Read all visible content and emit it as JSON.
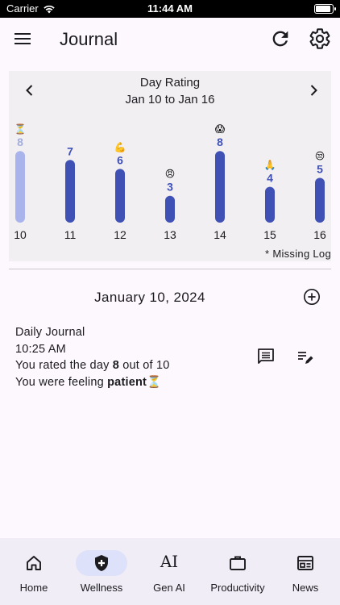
{
  "status_bar": {
    "carrier": "Carrier",
    "time": "11:44 AM"
  },
  "app_bar": {
    "title": "Journal"
  },
  "chart": {
    "title": "Day Rating",
    "subtitle": "Jan 10 to Jan 16",
    "missing_note": "* Missing Log"
  },
  "chart_data": {
    "type": "bar",
    "title": "Day Rating",
    "subtitle": "Jan 10 to Jan 16",
    "categories": [
      "10",
      "11",
      "12",
      "13",
      "14",
      "15",
      "16"
    ],
    "values": [
      8,
      7,
      6,
      3,
      8,
      4,
      5
    ],
    "emojis": [
      "⏳",
      "",
      "💪",
      "😠",
      "😱",
      "🙏",
      "😒"
    ],
    "missing": [
      true,
      false,
      false,
      false,
      false,
      false,
      false
    ],
    "ylim": [
      0,
      10
    ],
    "colors": {
      "bar": "#3f51b5",
      "missing_bar": "#aab4ec",
      "missing_label": "#a3addb"
    },
    "grid": false,
    "legend": "none"
  },
  "day": {
    "date": "January 10, 2024"
  },
  "entry": {
    "title": "Daily Journal",
    "time": "10:25 AM",
    "rating_prefix": "You rated the day ",
    "rating_value": "8",
    "rating_suffix": " out of 10",
    "feeling_prefix": "You were feeling ",
    "feeling_value": "patient",
    "feeling_emoji": "⏳"
  },
  "nav": {
    "items": [
      {
        "label": "Home",
        "icon": "home-icon"
      },
      {
        "label": "Wellness",
        "icon": "shield-plus-icon",
        "active": true
      },
      {
        "label": "Gen AI",
        "icon": "ai-text-icon",
        "text": "AI"
      },
      {
        "label": "Productivity",
        "icon": "briefcase-icon"
      },
      {
        "label": "News",
        "icon": "newspaper-icon"
      }
    ]
  },
  "colors": {
    "accent": "#3f51b5",
    "nav_active_pill": "#dde1f9",
    "background": "#fdf8fd"
  }
}
